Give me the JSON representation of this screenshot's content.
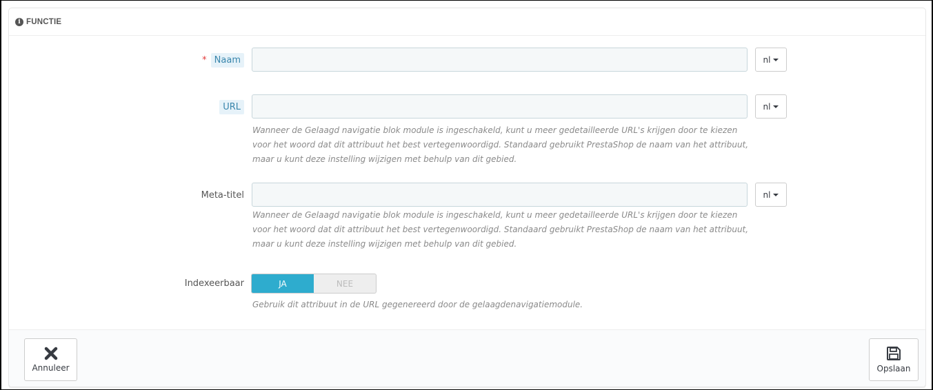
{
  "heading": {
    "icon": "info-icon",
    "title": "FUNCTIE"
  },
  "fields": {
    "naam": {
      "label": "Naam",
      "required_mark": "*",
      "value": "",
      "lang": "nl"
    },
    "url": {
      "label": "URL",
      "value": "",
      "lang": "nl",
      "help": "Wanneer de Gelaagd navigatie blok module is ingeschakeld, kunt u meer gedetailleerde URL's krijgen door te kiezen voor het woord dat dit attribuut het best vertegenwoordigd. Standaard gebruikt PrestaShop de naam van het attribuut, maar u kunt deze instelling wijzigen met behulp van dit gebied."
    },
    "meta_titel": {
      "label": "Meta-titel",
      "value": "",
      "lang": "nl",
      "help": "Wanneer de Gelaagd navigatie blok module is ingeschakeld, kunt u meer gedetailleerde URL's krijgen door te kiezen voor het woord dat dit attribuut het best vertegenwoordigd. Standaard gebruikt PrestaShop de naam van het attribuut, maar u kunt deze instelling wijzigen met behulp van dit gebied."
    },
    "indexeerbaar": {
      "label": "Indexeerbaar",
      "on_label": "JA",
      "off_label": "NEE",
      "selected": "JA",
      "help": "Gebruik dit attribuut in de URL gegenereerd door de gelaagdenavigatiemodule."
    }
  },
  "footer": {
    "cancel": {
      "label": "Annuleer",
      "icon": "close-icon"
    },
    "save": {
      "label": "Opslaan",
      "icon": "save-icon"
    }
  },
  "colors": {
    "accent": "#2eacce",
    "required": "#e23b3b",
    "label_tag_bg": "#e6f2f9",
    "label_tag_text": "#3986ac"
  }
}
